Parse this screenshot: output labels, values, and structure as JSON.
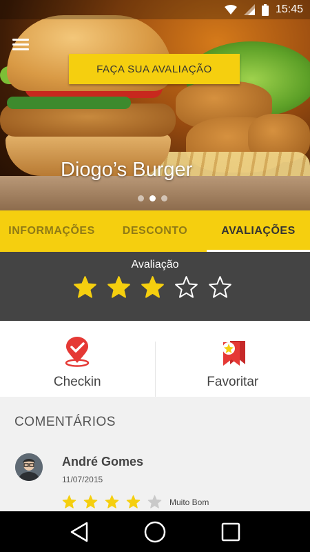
{
  "status_bar": {
    "time": "15:45",
    "icons": [
      "wifi-icon",
      "signal-icon",
      "battery-icon"
    ]
  },
  "hero": {
    "title": "Diogo’s Burger",
    "carousel": {
      "count": 3,
      "active_index": 1
    },
    "menu_icon": "menu-icon"
  },
  "tabs": [
    {
      "label": "INFORMAÇÕES",
      "active": false
    },
    {
      "label": "DESCONTO",
      "active": false
    },
    {
      "label": "AVALIAÇÕES",
      "active": true
    }
  ],
  "rating": {
    "title": "Avaliação",
    "stars_filled": 3,
    "stars_total": 5,
    "button_label": "FAÇA SUA AVALIAÇÃO"
  },
  "actions": [
    {
      "label": "Checkin",
      "icon": "location-check-icon"
    },
    {
      "label": "Favoritar",
      "icon": "bookmark-star-icon"
    }
  ],
  "comments": {
    "title": "COMENTÁRIOS",
    "items": [
      {
        "name": "André Gomes",
        "date": "11/07/2015",
        "stars_filled": 4,
        "stars_total": 5,
        "rating_label": "Muito Bom"
      }
    ]
  },
  "navbar": {
    "icons": [
      "back-icon",
      "home-icon",
      "recents-icon"
    ]
  },
  "colors": {
    "accent": "#F5CF0F",
    "dark_panel": "#444444",
    "checkin_red": "#E53935"
  }
}
